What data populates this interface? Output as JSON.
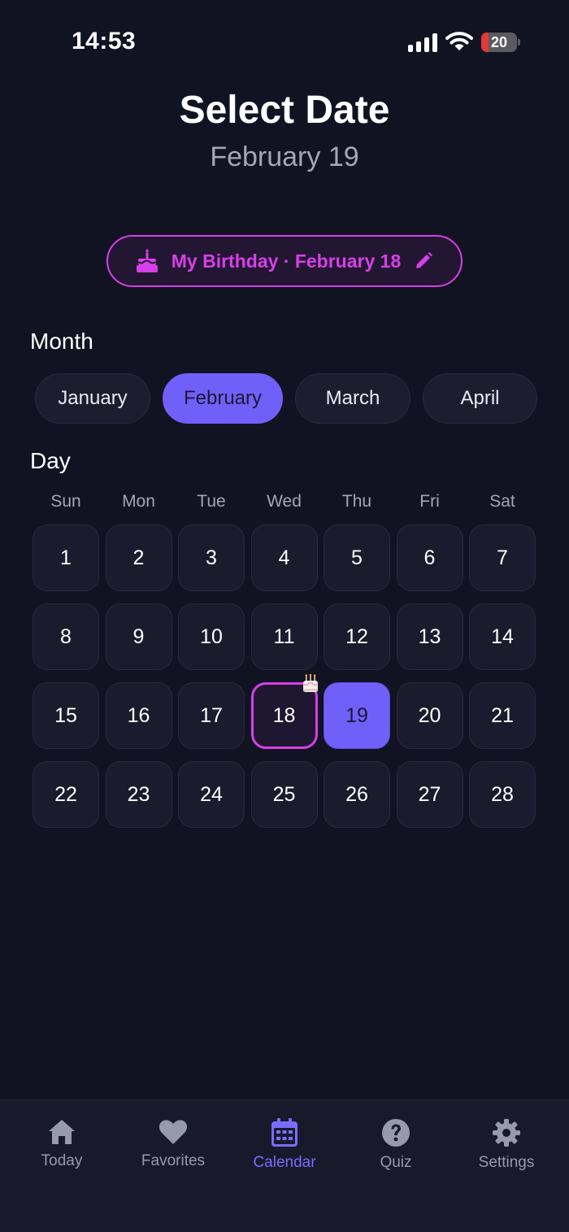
{
  "status_bar": {
    "time": "14:53",
    "battery_level": "20",
    "battery_fraction": 0.2,
    "battery_color": "#e23a3a"
  },
  "header": {
    "title": "Select Date",
    "subtitle": "February 19"
  },
  "birthday_pill": {
    "label": "My Birthday · February 18",
    "icon": "cake-icon",
    "action_icon": "pencil-icon",
    "color": "#d640e8"
  },
  "month_section": {
    "label": "Month",
    "months": [
      "January",
      "February",
      "March",
      "April"
    ],
    "selected": "February"
  },
  "day_section": {
    "label": "Day",
    "weekdays": [
      "Sun",
      "Mon",
      "Tue",
      "Wed",
      "Thu",
      "Fri",
      "Sat"
    ],
    "days": [
      [
        1,
        2,
        3,
        4,
        5,
        6,
        7
      ],
      [
        8,
        9,
        10,
        11,
        12,
        13,
        14
      ],
      [
        15,
        16,
        17,
        18,
        19,
        20,
        21
      ],
      [
        22,
        23,
        24,
        25,
        26,
        27,
        28
      ]
    ],
    "birthday_day": 18,
    "selected_day": 19,
    "accent_color": "#7060fa"
  },
  "tab_bar": {
    "tabs": [
      {
        "label": "Today",
        "icon": "home-icon"
      },
      {
        "label": "Favorites",
        "icon": "heart-icon"
      },
      {
        "label": "Calendar",
        "icon": "calendar-icon"
      },
      {
        "label": "Quiz",
        "icon": "question-circle-icon"
      },
      {
        "label": "Settings",
        "icon": "gear-icon"
      }
    ],
    "active": "Calendar"
  }
}
